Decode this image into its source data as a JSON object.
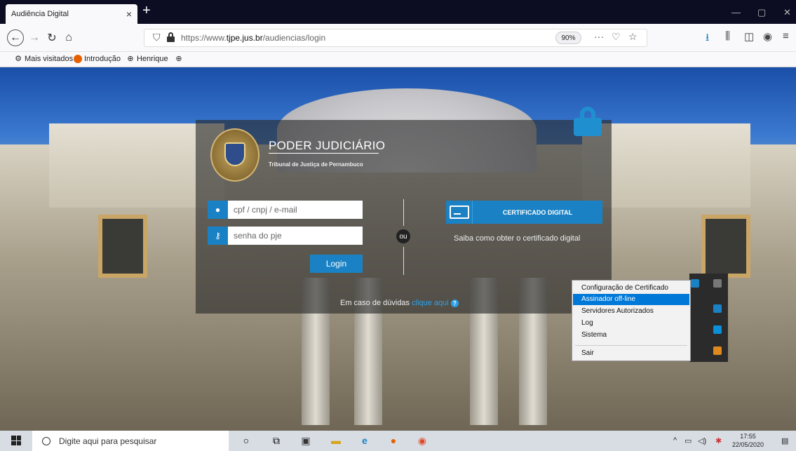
{
  "browser": {
    "tab_title": "Audiência Digital",
    "tab_close": "×",
    "new_tab": "+",
    "url_prefix": "https://www.",
    "url_domain": "tjpe.jus.br",
    "url_path": "/audiencias/login",
    "zoom": "90%",
    "more": "···",
    "bookmarks": [
      {
        "label": "Mais visitados",
        "icon": "gear-icon"
      },
      {
        "label": "Introdução",
        "icon": "firefox-icon"
      },
      {
        "label": "Henrique",
        "icon": "globe-icon"
      },
      {
        "label": "",
        "icon": "globe-icon"
      }
    ]
  },
  "login": {
    "header_title": "PODER JUDICIÁRIO",
    "header_subtitle": "Tribunal de Justiça de Pernambuco",
    "user_placeholder": "cpf / cnpj / e-mail",
    "password_placeholder": "senha do pje",
    "login_button": "Login",
    "or_label": "ou",
    "cert_button": "CERTIFICADO DIGITAL",
    "cert_help": "Saiba como obter o certificado digital",
    "doubt_text": "Em caso de dúvidas",
    "doubt_link": "clique aqui"
  },
  "context_menu": {
    "items": [
      "Configuração de Certificado",
      "Assinador off-line",
      "Servidores Autorizados",
      "Log",
      "Sistema",
      "Sair"
    ],
    "selected": "Assinador off-line"
  },
  "taskbar": {
    "search_placeholder": "Digite aqui para pesquisar",
    "time": "17:55",
    "date": "22/05/2020"
  },
  "colors": {
    "accent": "#1a82c4",
    "link": "#2ea0ea",
    "menu_selected": "#0078d7"
  }
}
